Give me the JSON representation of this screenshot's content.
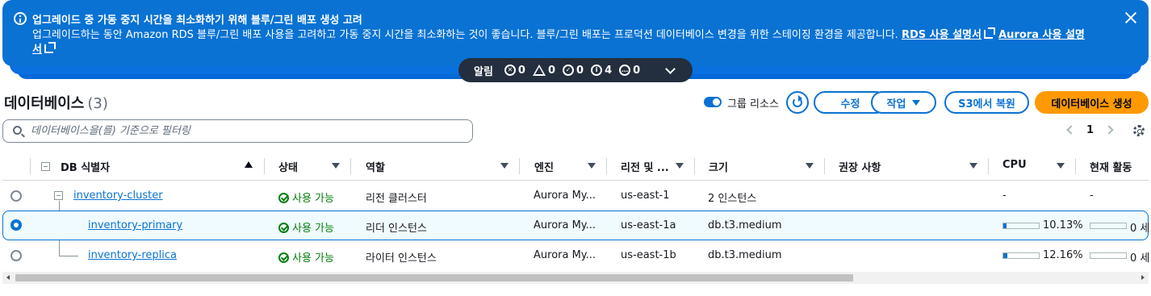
{
  "banner": {
    "title": "업그레이드 중 가동 중지 시간을 최소화하기 위해 블루/그린 배포 생성 고려",
    "body": "업그레이드하는 동안 Amazon RDS 블루/그린 배포 사용을 고려하고 가동 중지 시간을 최소화하는 것이 좋습니다. 블루/그린 배포는 프로덕션 데이터베이스 변경을 위한 스테이징 환경을 제공합니다.",
    "link_rds": "RDS 사용 설명서",
    "link_aurora": "Aurora 사용 설명서"
  },
  "notifications": {
    "label": "알림",
    "errors": "0",
    "warnings": "0",
    "success": "0",
    "info": "4",
    "in_progress": "0"
  },
  "header": {
    "title": "데이터베이스",
    "count": "(3)",
    "group_toggle_label": "그룹 리소스",
    "modify_label": "수정",
    "actions_label": "작업",
    "restore_label": "S3에서 복원",
    "create_label": "데이터베이스 생성"
  },
  "filter": {
    "placeholder": "데이터베이스을(를) 기준으로 필터링",
    "value": ""
  },
  "pagination": {
    "current_page": "1"
  },
  "columns": {
    "id": "DB 식별자",
    "status": "상태",
    "role": "역할",
    "engine": "엔진",
    "region": "리전 및 ...",
    "size": "크기",
    "recommendations": "권장 사항",
    "cpu": "CPU",
    "activity": "현재 활동"
  },
  "rows": [
    {
      "id": "inventory-cluster",
      "status": "사용 가능",
      "role": "리전 클러스터",
      "engine": "Aurora My...",
      "region": "us-east-1",
      "size": "2 인스턴스",
      "cpu": "-",
      "cpu_fraction": null,
      "activity": "-"
    },
    {
      "id": "inventory-primary",
      "status": "사용 가능",
      "role": "리더 인스턴스",
      "engine": "Aurora My...",
      "region": "us-east-1a",
      "size": "db.t3.medium",
      "cpu": "10.13%",
      "cpu_fraction": 0.1013,
      "activity": "0 세"
    },
    {
      "id": "inventory-replica",
      "status": "사용 가능",
      "role": "라이터 인스턴스",
      "engine": "Aurora My...",
      "region": "us-east-1b",
      "size": "db.t3.medium",
      "cpu": "12.16%",
      "cpu_fraction": 0.1216,
      "activity": "0 세"
    }
  ],
  "colors": {
    "primary": "#0972d3",
    "banner": "#0972d3",
    "success": "#037f0c",
    "create_button": "#ff9900"
  }
}
